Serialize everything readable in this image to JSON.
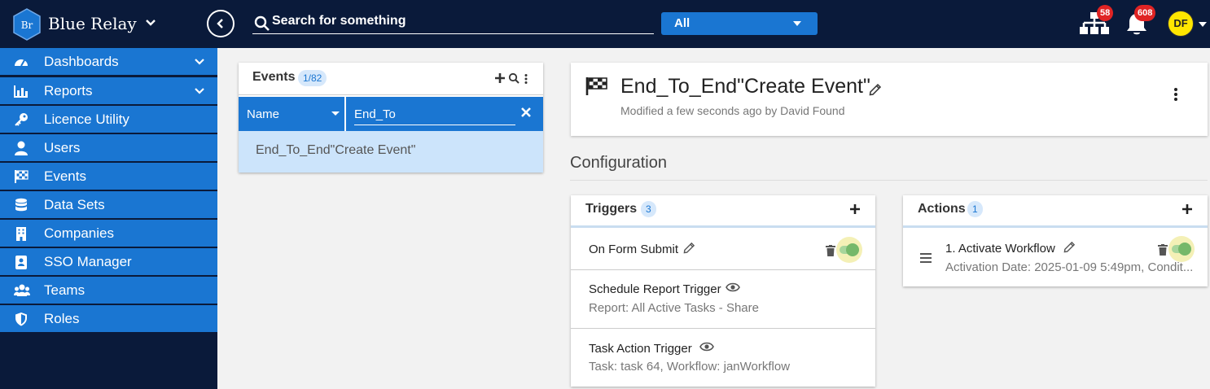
{
  "app": {
    "logo_text": "Br",
    "brand": "Blue Relay",
    "colors": {
      "navy": "#0a1a3a",
      "blue": "#1a76d2",
      "badge_red": "#e02424",
      "avatar_yellow": "#ffe600"
    }
  },
  "topbar": {
    "search_placeholder": "Search for something",
    "scope": "All",
    "hierarchy_badge": "58",
    "notifications_badge": "608",
    "avatar_initials": "DF"
  },
  "sidebar": {
    "items": [
      {
        "label": "Dashboards",
        "icon": "gauge-icon"
      },
      {
        "label": "Reports",
        "icon": "bar-chart-icon"
      },
      {
        "label": "Licence Utility",
        "icon": "key-icon"
      },
      {
        "label": "Users",
        "icon": "user-icon"
      },
      {
        "label": "Events",
        "icon": "checkered-flag-icon"
      },
      {
        "label": "Data Sets",
        "icon": "database-icon"
      },
      {
        "label": "Companies",
        "icon": "building-icon"
      },
      {
        "label": "SSO Manager",
        "icon": "id-badge-icon"
      },
      {
        "label": "Teams",
        "icon": "users-icon"
      },
      {
        "label": "Roles",
        "icon": "shield-icon"
      }
    ]
  },
  "events_panel": {
    "title": "Events",
    "count": "1/82",
    "filter_field": "Name",
    "filter_value": "End_To",
    "results": [
      "End_To_End\"Create Event\""
    ]
  },
  "event": {
    "title": "End_To_End\"Create Event\"",
    "modified": "Modified a few seconds ago by David Found"
  },
  "configuration": {
    "heading": "Configuration",
    "triggers": {
      "title": "Triggers",
      "count": "3",
      "items": [
        {
          "title": "On Form Submit",
          "subtitle": ""
        },
        {
          "title": "Schedule Report Trigger",
          "subtitle": "Report: All Active Tasks - Share"
        },
        {
          "title": "Task Action Trigger",
          "subtitle": "Task: task 64, Workflow: janWorkflow"
        }
      ]
    },
    "actions": {
      "title": "Actions",
      "count": "1",
      "items": [
        {
          "title": "1. Activate Workflow",
          "subtitle": "Activation Date: 2025-01-09 5:49pm, Condit..."
        }
      ]
    }
  }
}
